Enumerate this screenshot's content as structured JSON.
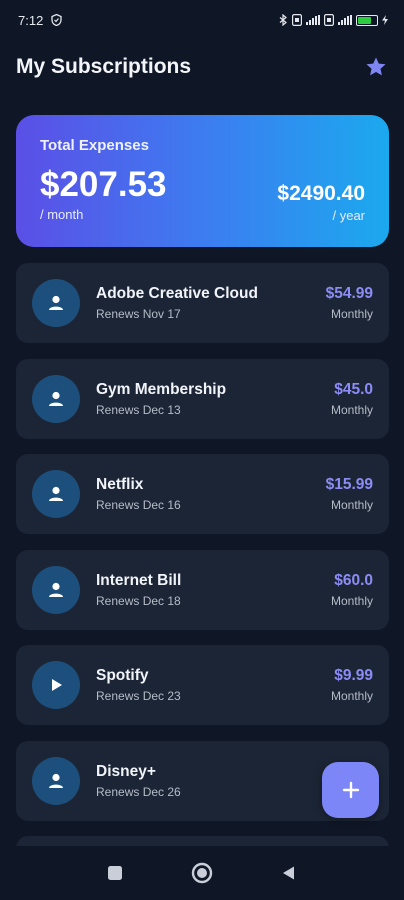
{
  "status_bar": {
    "time": "7:12",
    "battery": "95"
  },
  "header": {
    "title": "My Subscriptions"
  },
  "total": {
    "label": "Total Expenses",
    "monthly_amount": "$207.53",
    "monthly_unit": "/ month",
    "yearly_amount": "$2490.40",
    "yearly_unit": "/ year"
  },
  "subscriptions": [
    {
      "name": "Adobe Creative Cloud",
      "renews": "Renews Nov 17",
      "price": "$54.99",
      "cycle": "Monthly",
      "icon": "person-icon"
    },
    {
      "name": "Gym Membership",
      "renews": "Renews Dec 13",
      "price": "$45.0",
      "cycle": "Monthly",
      "icon": "person-icon"
    },
    {
      "name": "Netflix",
      "renews": "Renews Dec 16",
      "price": "$15.99",
      "cycle": "Monthly",
      "icon": "person-icon"
    },
    {
      "name": "Internet Bill",
      "renews": "Renews Dec 18",
      "price": "$60.0",
      "cycle": "Monthly",
      "icon": "person-icon"
    },
    {
      "name": "Spotify",
      "renews": "Renews Dec 23",
      "price": "$9.99",
      "cycle": "Monthly",
      "icon": "play-icon"
    },
    {
      "name": "Disney+",
      "renews": "Renews Dec 26",
      "price": "",
      "cycle": "",
      "icon": "person-icon"
    }
  ],
  "colors": {
    "background": "#0f1626",
    "card": "#1c2535",
    "accent": "#8d8cf5",
    "fab": "#7d86f6",
    "icon_circle": "#1d4f7d",
    "gradient_start": "#5b4fe6",
    "gradient_end": "#1ba9ee"
  }
}
